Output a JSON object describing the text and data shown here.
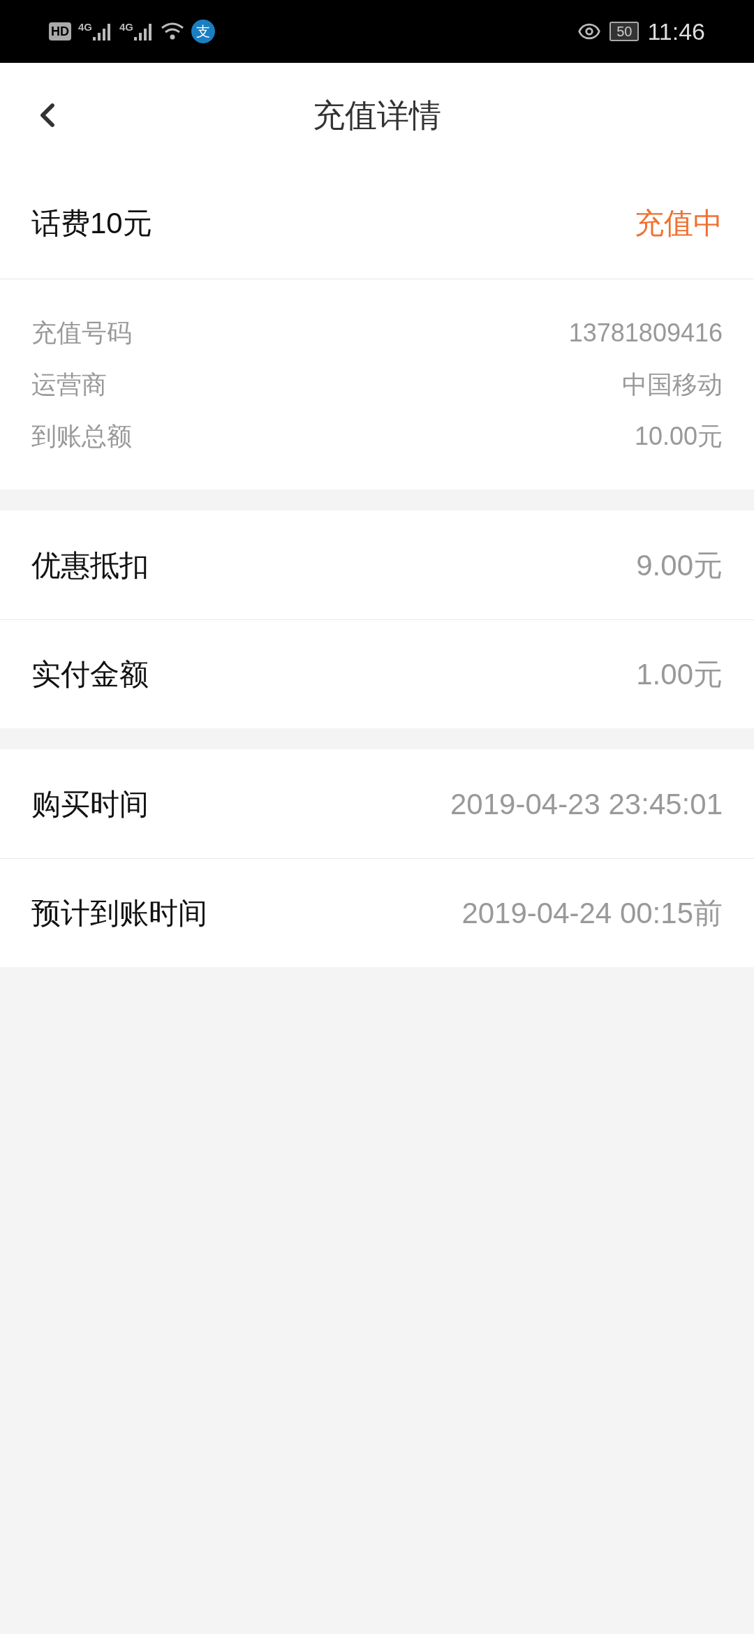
{
  "status_bar": {
    "hd": "HD",
    "network_1": "4G",
    "network_2": "4G",
    "app_badge": "支",
    "battery": "50",
    "time": "11:46"
  },
  "header": {
    "title": "充值详情"
  },
  "order": {
    "product": "话费10元",
    "status": "充值中"
  },
  "details": [
    {
      "label": "充值号码",
      "value": "13781809416"
    },
    {
      "label": "运营商",
      "value": "中国移动"
    },
    {
      "label": "到账总额",
      "value": "10.00元"
    }
  ],
  "sections": [
    [
      {
        "label": "优惠抵扣",
        "value": "9.00元"
      },
      {
        "label": "实付金额",
        "value": "1.00元"
      }
    ],
    [
      {
        "label": "购买时间",
        "value": "2019-04-23 23:45:01"
      },
      {
        "label": "预计到账时间",
        "value": "2019-04-24 00:15前"
      }
    ]
  ]
}
